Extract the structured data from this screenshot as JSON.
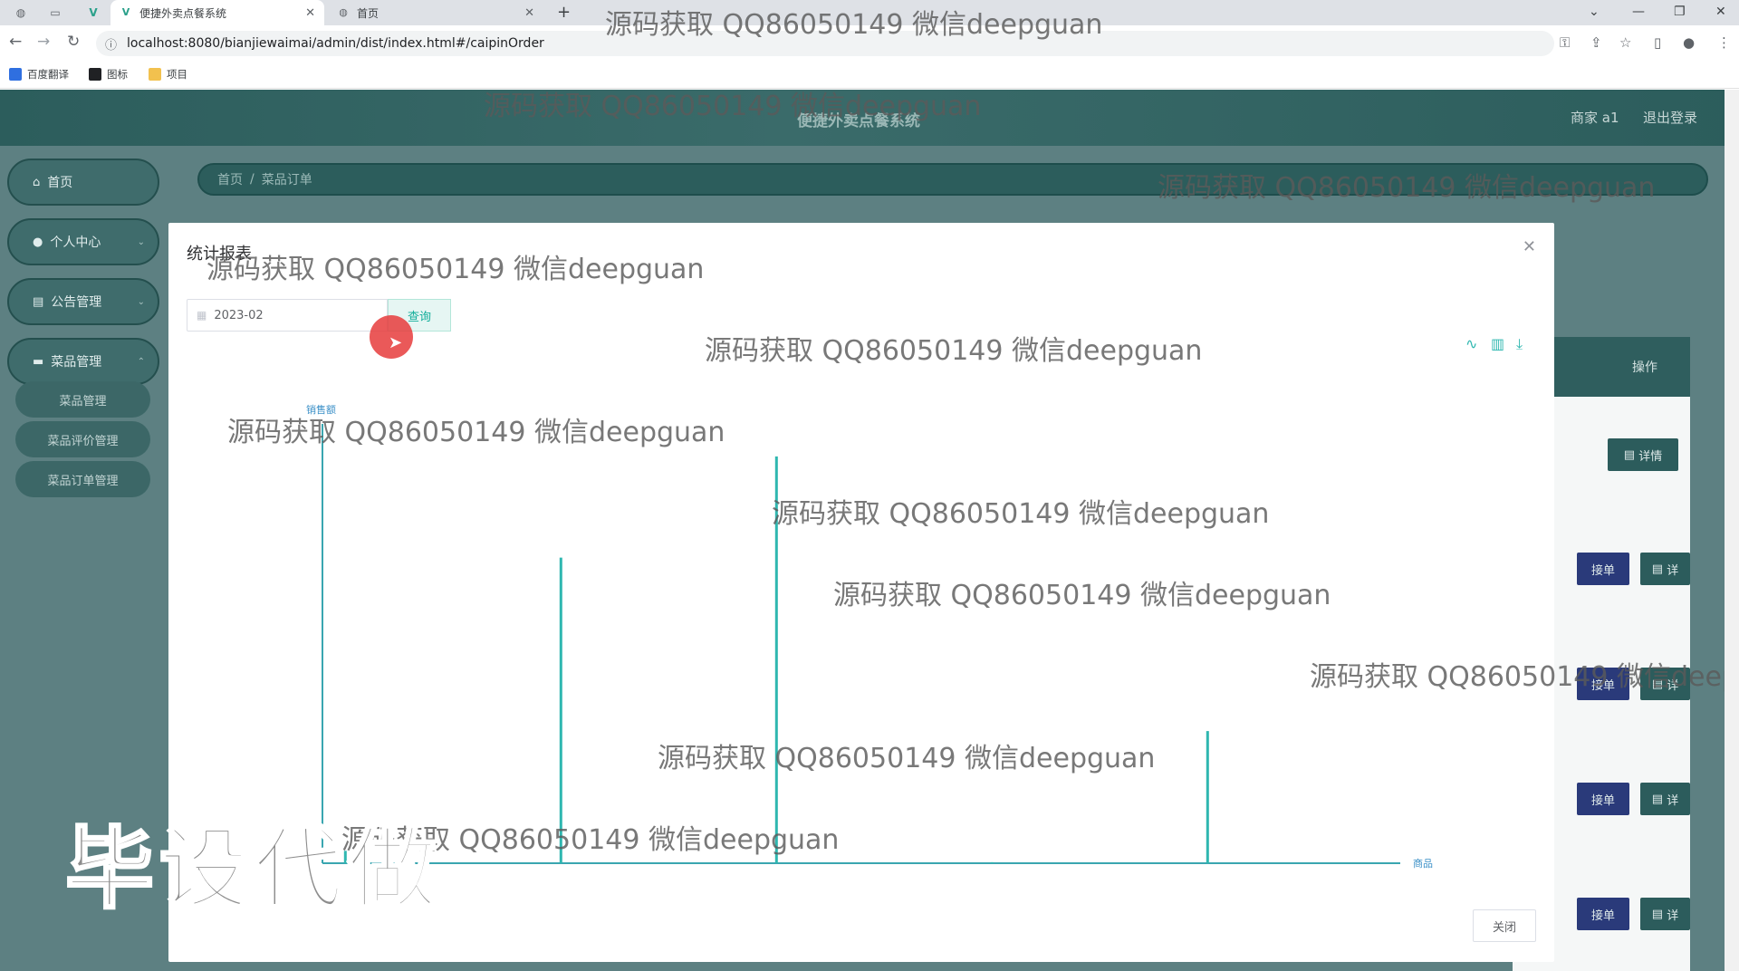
{
  "browser": {
    "tabs": [
      {
        "title": "便捷外卖点餐系统",
        "active": true
      },
      {
        "title": "首页",
        "active": false
      }
    ],
    "url": "localhost:8080/bianjiewaimai/admin/dist/index.html#/caipinOrder",
    "bookmarks": [
      "百度翻译",
      "图标",
      "项目"
    ]
  },
  "app": {
    "title": "便捷外卖点餐系统",
    "user": "商家 a1",
    "logout": "退出登录",
    "menu": [
      {
        "label": "首页",
        "icon": "home-icon"
      },
      {
        "label": "个人中心",
        "icon": "user-icon"
      },
      {
        "label": "公告管理",
        "icon": "notice-icon"
      },
      {
        "label": "菜品管理",
        "icon": "dish-icon"
      }
    ],
    "submenu": [
      "菜品管理",
      "菜品评价管理",
      "菜品订单管理"
    ],
    "breadcrumb": [
      "首页",
      "菜品订单"
    ],
    "table": {
      "header_action": "操作",
      "btn_accept": "接单",
      "btn_detail": "详情",
      "btn_detail_clipped": "详"
    }
  },
  "modal": {
    "title": "统计报表",
    "date_value": "2023-02",
    "query_label": "查询",
    "close_label": "关闭"
  },
  "chart_data": {
    "type": "bar",
    "ylabel": "销售额",
    "xlabel": "商品",
    "categories": [
      "",
      "",
      "",
      "",
      ""
    ],
    "values": [
      12,
      296,
      394,
      1,
      128
    ],
    "note": "values read relative to bar heights; axis ticks not printed"
  },
  "watermarks": {
    "text": "源码获取 QQ86050149 微信deepguan",
    "clipped": "源码获取 QQ86050149 微信deepg",
    "stamp": "毕设代做"
  }
}
